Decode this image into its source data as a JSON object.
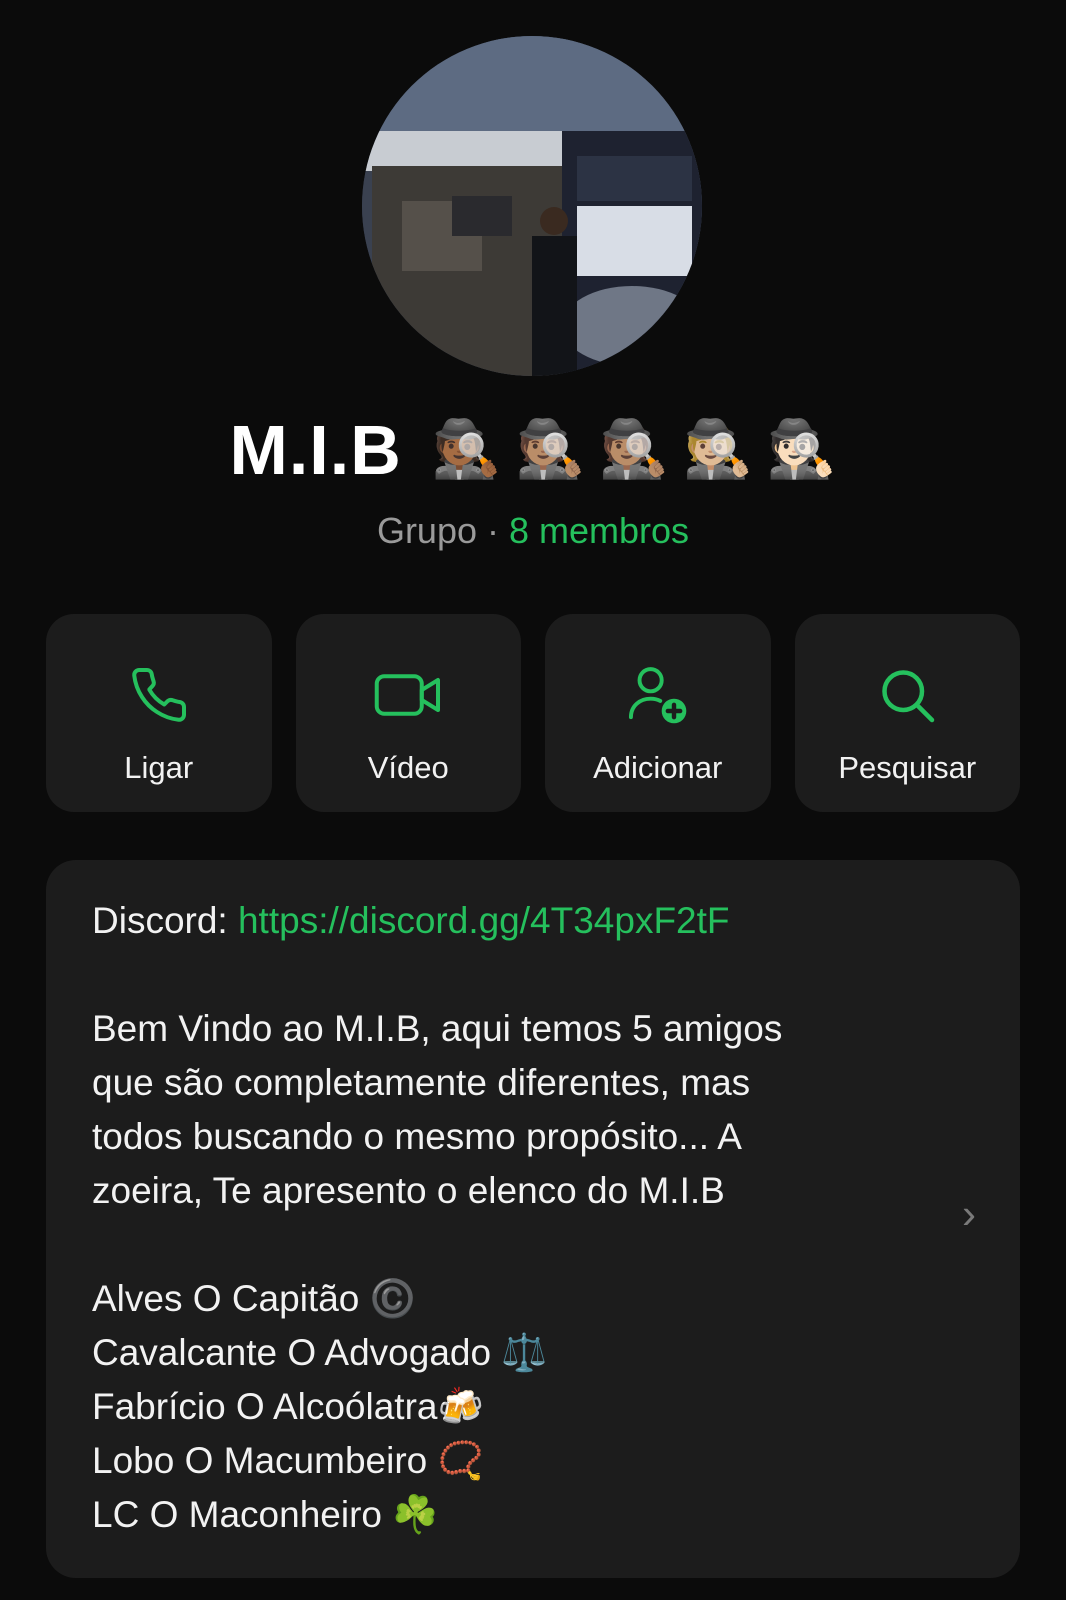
{
  "profile": {
    "name": "M.I.B",
    "name_emojis": [
      "🕵🏾",
      "🕵🏽",
      "🕵🏽",
      "🕵🏼",
      "🕵🏻"
    ],
    "subtitle_type": "Grupo",
    "subtitle_sep": " · ",
    "members": "8 membros"
  },
  "actions": [
    {
      "label": "Ligar",
      "icon": "phone-icon"
    },
    {
      "label": "Vídeo",
      "icon": "video-icon"
    },
    {
      "label": "Adicionar",
      "icon": "add-user-icon"
    },
    {
      "label": "Pesquisar",
      "icon": "search-icon"
    }
  ],
  "description": {
    "discord_label": "Discord: ",
    "discord_link": "https://discord.gg/4T34pxF2tF",
    "intro": [
      "Bem Vindo ao M.I.B, aqui temos 5 amigos",
      "que são completamente diferentes, mas",
      "todos buscando o mesmo propósito... A",
      "zoeira, Te apresento o elenco do M.I.B"
    ],
    "cast": [
      {
        "text": "Alves O Capitão ",
        "emoji": "©️"
      },
      {
        "text": "Cavalcante O Advogado ",
        "emoji": "⚖️"
      },
      {
        "text": "Fabrício O Alcoólatra",
        "emoji": "🍻"
      },
      {
        "text": "Lobo O Macumbeiro ",
        "emoji": "📿"
      },
      {
        "text": "LC O Maconheiro ",
        "emoji": "☘️"
      }
    ]
  },
  "colors": {
    "accent": "#25c05d",
    "background": "#0b0b0b",
    "card": "#1c1c1c"
  }
}
